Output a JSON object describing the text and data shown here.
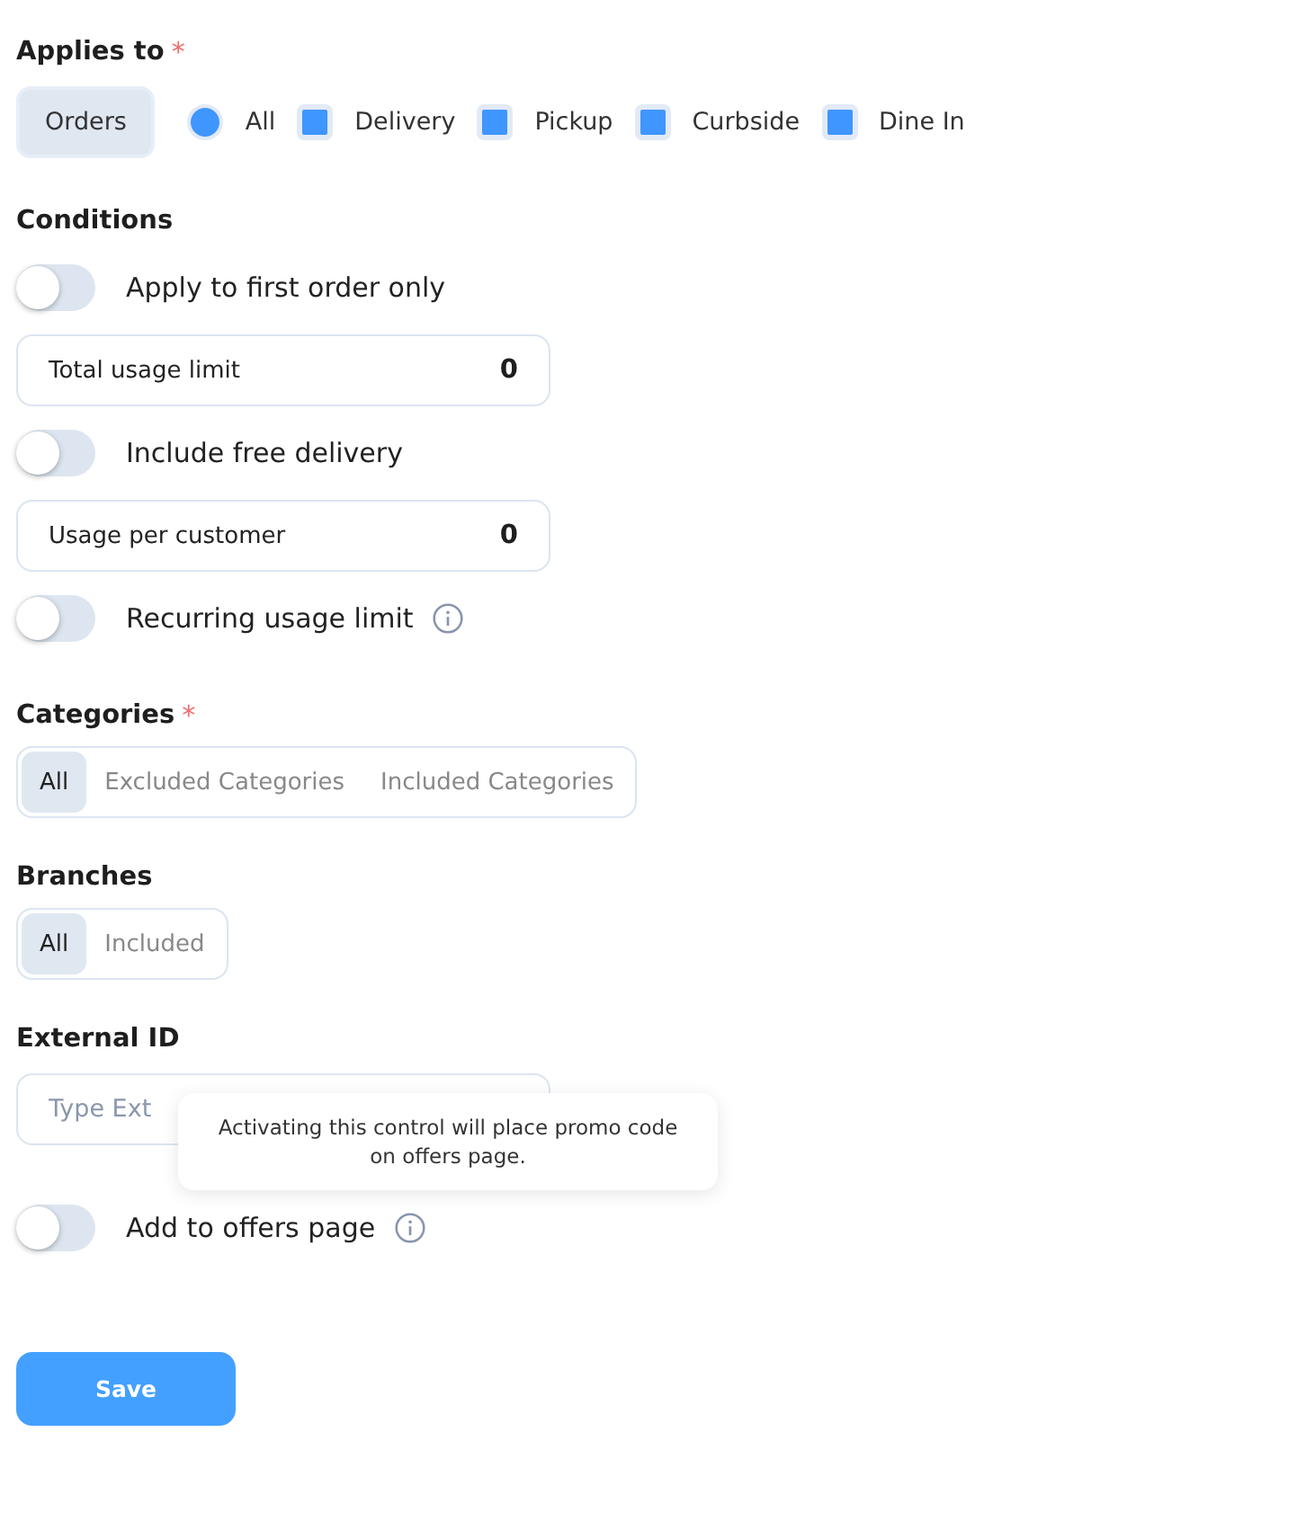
{
  "applies_to": {
    "label": "Applies to",
    "required_mark": "*",
    "orders_button": {
      "label": "Orders",
      "selected": true
    },
    "options": [
      {
        "kind": "radio",
        "label": "All",
        "checked": true
      },
      {
        "kind": "checkbox",
        "label": "Delivery",
        "checked": true
      },
      {
        "kind": "checkbox",
        "label": "Pickup",
        "checked": true
      },
      {
        "kind": "checkbox",
        "label": "Curbside",
        "checked": true
      },
      {
        "kind": "checkbox",
        "label": "Dine In",
        "checked": true
      }
    ]
  },
  "conditions": {
    "label": "Conditions",
    "items": [
      {
        "kind": "toggle",
        "label": "Apply to first order only",
        "on": false,
        "info": false
      },
      {
        "kind": "number",
        "label": "Total usage limit",
        "value": "0"
      },
      {
        "kind": "toggle",
        "label": "Include free delivery",
        "on": false,
        "info": false
      },
      {
        "kind": "number",
        "label": "Usage per customer",
        "value": "0"
      },
      {
        "kind": "toggle",
        "label": "Recurring usage limit",
        "on": false,
        "info": true
      }
    ]
  },
  "categories": {
    "label": "Categories",
    "required_mark": "*",
    "segments": [
      {
        "label": "All",
        "selected": true
      },
      {
        "label": "Excluded Categories",
        "selected": false
      },
      {
        "label": "Included Categories",
        "selected": false
      }
    ]
  },
  "branches": {
    "label": "Branches",
    "segments": [
      {
        "label": "All",
        "selected": true
      },
      {
        "label": "Included",
        "selected": false
      }
    ]
  },
  "external_id": {
    "label": "External ID",
    "placeholder": "Type Ext"
  },
  "tooltip": "Activating this control will place promo code on offers page.",
  "offers_toggle": {
    "label": "Add to offers page",
    "on": false,
    "info": true
  },
  "save_button": "Save"
}
